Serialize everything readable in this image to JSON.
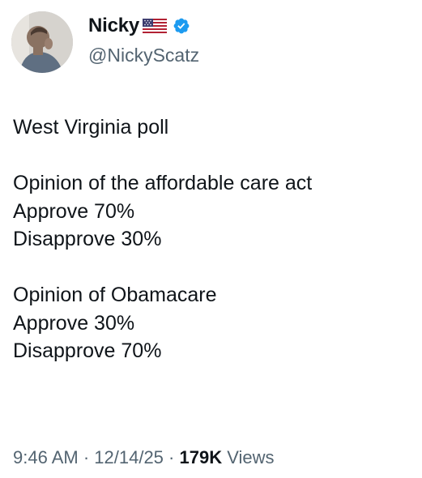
{
  "author": {
    "display_name": "Nicky",
    "handle": "@NickyScatz"
  },
  "tweet": {
    "line_1": "West Virginia  poll",
    "line_2": "Opinion of the affordable care act",
    "line_3": "Approve 70%",
    "line_4": "Disapprove 30%",
    "line_5": "Opinion of Obamacare",
    "line_6": "Approve 30%",
    "line_7": "Disapprove 70%"
  },
  "meta": {
    "time": "9:46 AM",
    "separator_1": " · ",
    "date": "12/14/25",
    "separator_2": " · ",
    "views_count": "179K",
    "views_label": " Views"
  },
  "icons": {
    "flag": "us-flag-icon",
    "verified": "verified-badge-icon"
  },
  "colors": {
    "verified": "#1d9bf0",
    "secondary_text": "#536471",
    "primary_text": "#0f1419"
  }
}
